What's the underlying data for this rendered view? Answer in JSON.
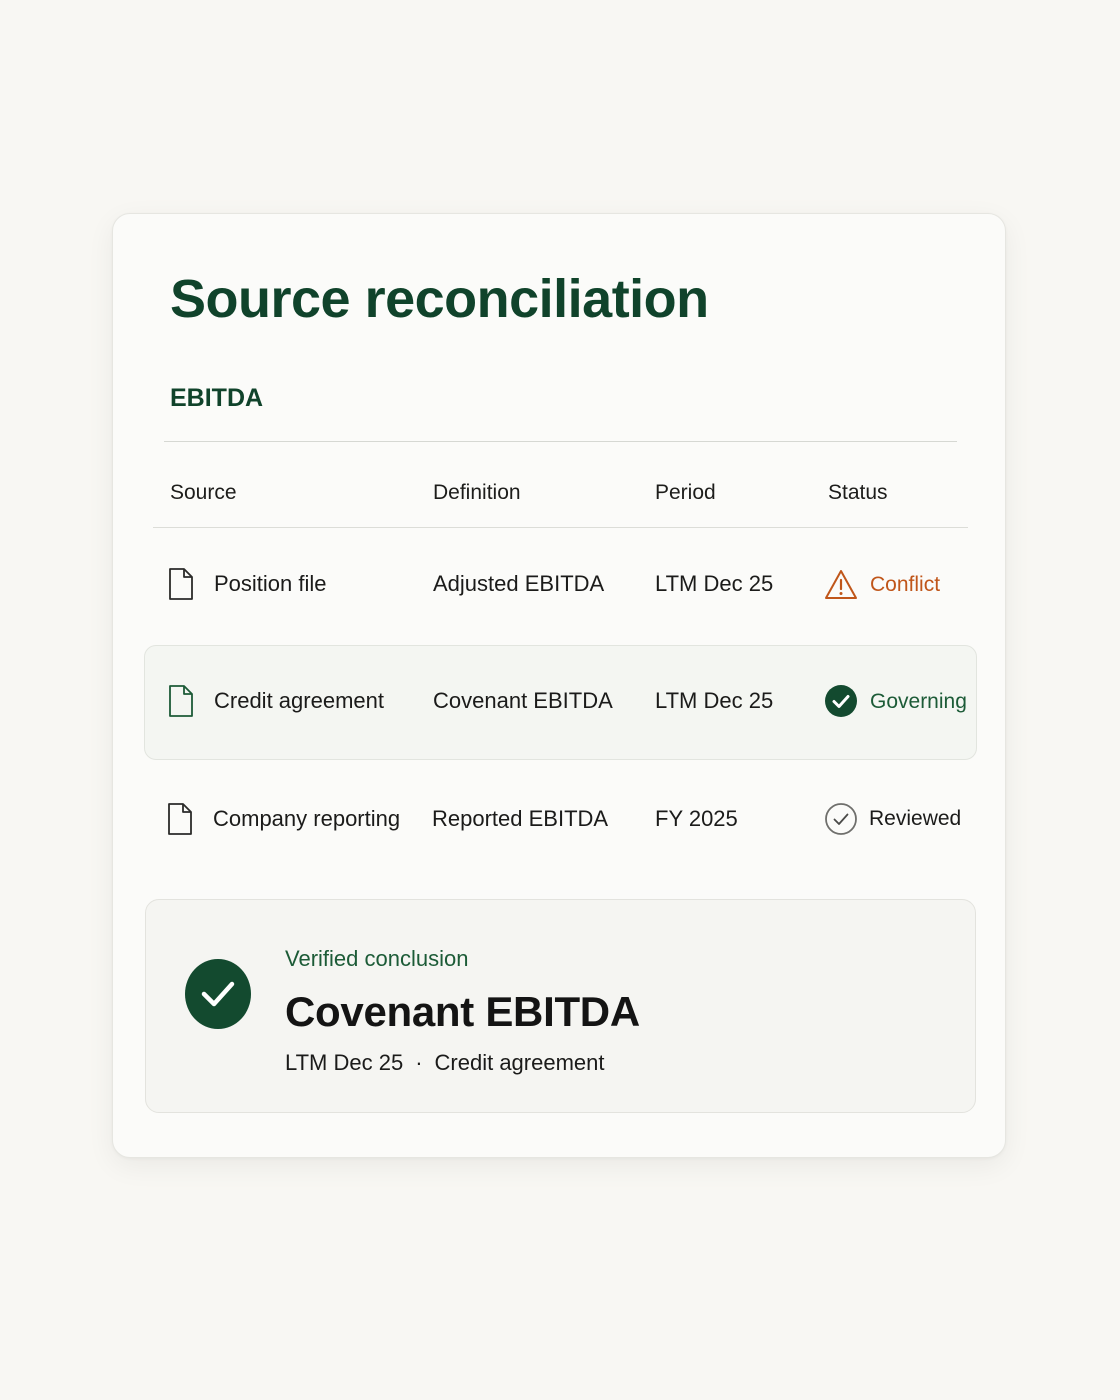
{
  "panel": {
    "title": "Source reconciliation",
    "metric": "EBITDA"
  },
  "table": {
    "headers": {
      "source": "Source",
      "definition": "Definition",
      "period": "Period",
      "status": "Status"
    },
    "rows": [
      {
        "source": "Position file",
        "definition": "Adjusted EBITDA",
        "period": "LTM Dec 25",
        "status": "Conflict",
        "status_icon": "warning-triangle-icon",
        "status_color": "#c0561a"
      },
      {
        "source": "Credit agreement",
        "definition": "Covenant EBITDA",
        "period": "LTM Dec 25",
        "status": "Governing",
        "status_icon": "check-circle-filled-icon",
        "status_color": "#1c5b37"
      },
      {
        "source": "Company reporting",
        "definition": "Reported EBITDA",
        "period": "FY 2025",
        "status": "Reviewed",
        "status_icon": "check-circle-outline-icon",
        "status_color": "#1b1b1a"
      }
    ]
  },
  "conclusion": {
    "label": "Verified conclusion",
    "value": "Covenant EBITDA",
    "period": "LTM Dec 25",
    "separator": "·",
    "source": "Credit agreement"
  },
  "colors": {
    "brand_green": "#10432b",
    "accent_green": "#1c5b37",
    "conflict_orange": "#c0561a",
    "background": "#f8f7f3"
  }
}
